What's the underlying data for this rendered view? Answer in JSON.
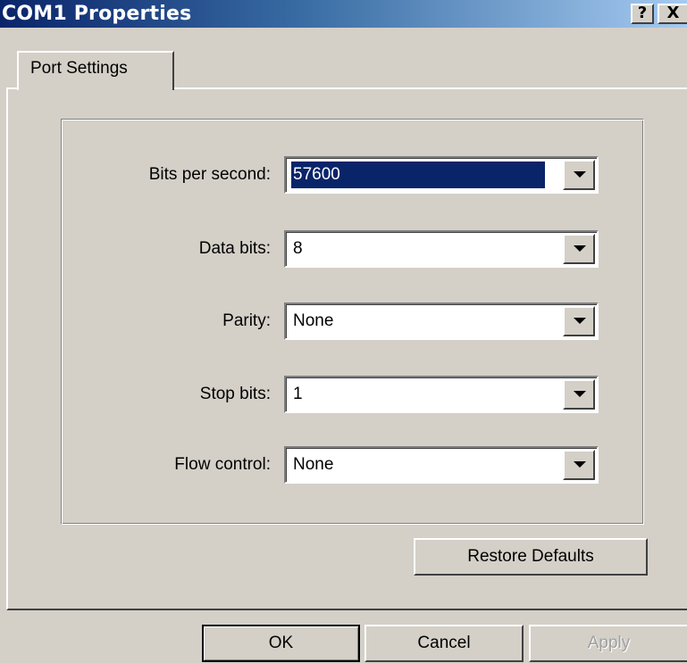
{
  "window": {
    "title": "COM1 Properties",
    "help_glyph": "?",
    "close_glyph": "X"
  },
  "tabs": [
    {
      "label": "Port Settings",
      "active": true
    }
  ],
  "settings": {
    "bits_per_second": {
      "label": "Bits per second:",
      "value": "57600",
      "selected": true
    },
    "data_bits": {
      "label": "Data bits:",
      "value": "8"
    },
    "parity": {
      "label": "Parity:",
      "value": "None"
    },
    "stop_bits": {
      "label": "Stop bits:",
      "value": "1"
    },
    "flow_control": {
      "label": "Flow control:",
      "value": "None"
    }
  },
  "buttons": {
    "restore_defaults": "Restore Defaults",
    "ok": "OK",
    "cancel": "Cancel",
    "apply": "Apply"
  },
  "colors": {
    "face": "#d4d0c8",
    "selection": "#0a246a",
    "title_gradient_start": "#0a246a",
    "title_gradient_end": "#a6caf0"
  }
}
